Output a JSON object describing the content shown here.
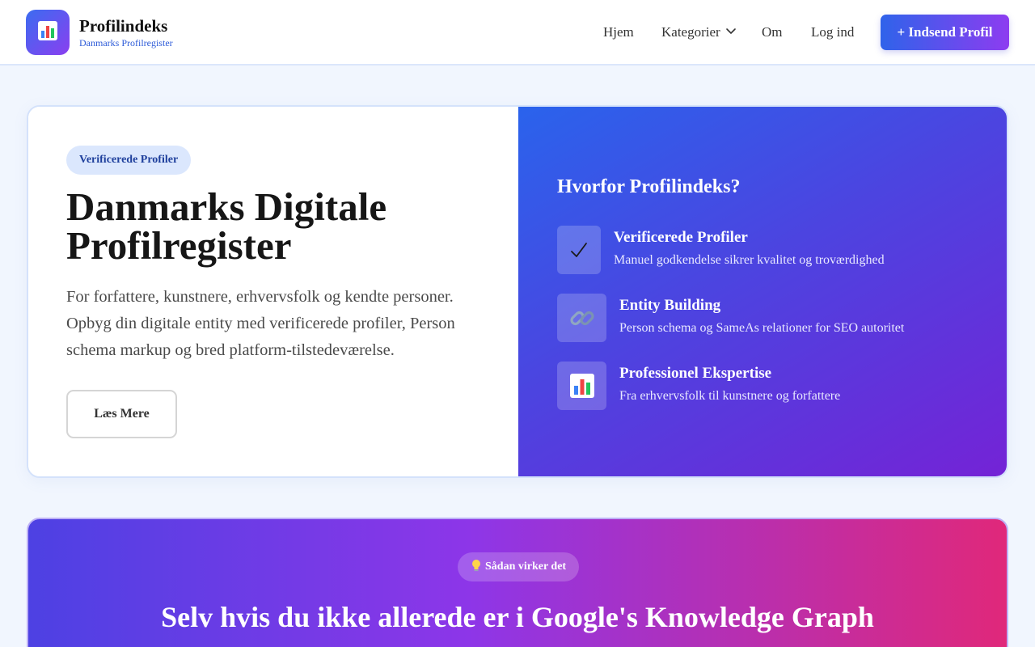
{
  "header": {
    "logo_icon": "bar-chart-icon",
    "brand_title": "Profilindeks",
    "brand_subtitle": "Danmarks Profilregister",
    "nav": {
      "home": "Hjem",
      "categories": "Kategorier",
      "about": "Om",
      "login": "Log ind"
    },
    "submit_button": "+ Indsend Profil"
  },
  "hero": {
    "badge": "Verificerede Profiler",
    "title": "Danmarks Digitale Profilregister",
    "description": "For forfattere, kunstnere, erhvervsfolk og kendte personer. Opbyg din digitale entity med verificerede profiler, Person schema markup og bred platform-tilstedeværelse.",
    "read_more": "Læs Mere",
    "why_title": "Hvorfor Profilindeks?",
    "features": [
      {
        "icon": "checkmark-icon",
        "title": "Verificerede Profiler",
        "description": "Manuel godkendelse sikrer kvalitet og troværdighed"
      },
      {
        "icon": "link-icon",
        "title": "Entity Building",
        "description": "Person schema og SameAs relationer for SEO autoritet"
      },
      {
        "icon": "bar-chart-icon",
        "title": "Professionel Ekspertise",
        "description": "Fra erhvervsfolk til kunstnere og forfattere"
      }
    ]
  },
  "how": {
    "badge_icon": "lightbulb-icon",
    "badge": "Sådan virker det",
    "title": "Selv hvis du ikke allerede er i Google's Knowledge Graph"
  },
  "colors": {
    "accent_blue": "#2f63ea",
    "accent_purple": "#8d3cf0",
    "accent_pink": "#e0287a",
    "page_background": "#f1f6fe"
  }
}
